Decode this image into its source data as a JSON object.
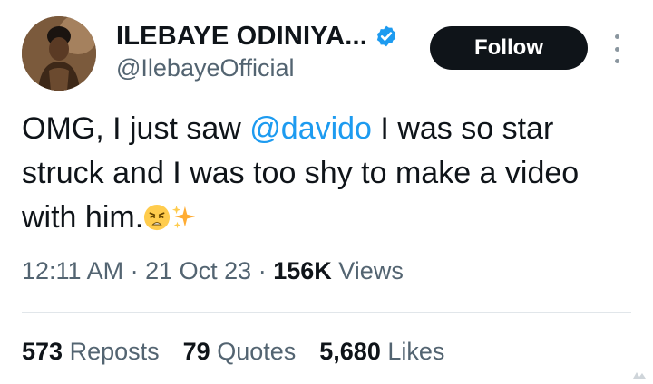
{
  "author": {
    "display_name": "ILEBAYE ODINIYA...",
    "handle": "@IlebayeOfficial",
    "verified_icon": "verified-badge-icon",
    "accent_color": "#1d9bf0"
  },
  "follow_button": {
    "label": "Follow"
  },
  "tweet": {
    "text_before": "OMG, I just saw ",
    "mention": "@davido",
    "text_after": " I was so star struck and I was too shy to make a video with him.",
    "emojis": [
      "weary-face-emoji",
      "sparkles-emoji"
    ]
  },
  "meta": {
    "time": "12:11 AM",
    "separator": "·",
    "date": "21 Oct 23",
    "views_count": "156K",
    "views_label": "Views"
  },
  "stats": {
    "reposts_count": "573",
    "reposts_label": "Reposts",
    "quotes_count": "79",
    "quotes_label": "Quotes",
    "likes_count": "5,680",
    "likes_label": "Likes"
  }
}
